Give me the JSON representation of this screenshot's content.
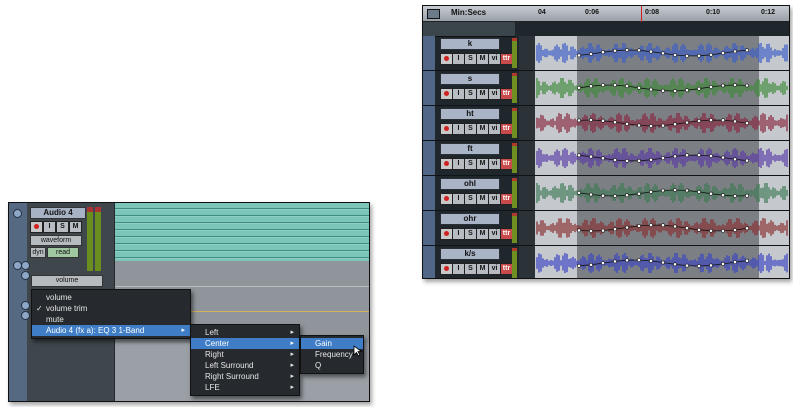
{
  "left_panel": {
    "track_name": "Audio 4",
    "buttons": [
      "",
      "I",
      "S",
      "M"
    ],
    "view_select": "waveform",
    "dyn_label": "dyn",
    "automation_mode": "read",
    "automation_lane": "volume",
    "menu": {
      "items": [
        {
          "label": "volume",
          "checked": false
        },
        {
          "label": "volume trim",
          "checked": true
        },
        {
          "label": "mute",
          "checked": false
        },
        {
          "label": "Audio 4  (fx a): EQ 3 1-Band",
          "checked": false,
          "submenu": true,
          "active": true
        }
      ]
    },
    "submenu": {
      "items": [
        {
          "label": "Left",
          "submenu": true
        },
        {
          "label": "Center",
          "submenu": true,
          "active": true
        },
        {
          "label": "Right",
          "submenu": true
        },
        {
          "label": "Left Surround",
          "submenu": true
        },
        {
          "label": "Right Surround",
          "submenu": true
        },
        {
          "label": "LFE",
          "submenu": true
        }
      ]
    },
    "submenu2": {
      "items": [
        {
          "label": "Gain",
          "active": true
        },
        {
          "label": "Frequency"
        },
        {
          "label": "Q"
        }
      ]
    }
  },
  "right_panel": {
    "ruler_label": "Min:Secs",
    "ruler_ticks": [
      {
        "label": "04"
      },
      {
        "label": "0:06"
      },
      {
        "label": "0:08"
      },
      {
        "label": "0:10"
      },
      {
        "label": "0:12"
      }
    ],
    "tracks": [
      {
        "name": "k",
        "color": "#3d5ec9"
      },
      {
        "name": "s",
        "color": "#3f8a3a"
      },
      {
        "name": "ht",
        "color": "#8a2740"
      },
      {
        "name": "ft",
        "color": "#5a3aa8"
      },
      {
        "name": "ohl",
        "color": "#3f7a55"
      },
      {
        "name": "ohr",
        "color": "#8a3030"
      },
      {
        "name": "k/s",
        "color": "#3c45c4"
      }
    ],
    "track_buttons": [
      "",
      "I",
      "S",
      "M",
      "vi",
      "ttr"
    ]
  }
}
